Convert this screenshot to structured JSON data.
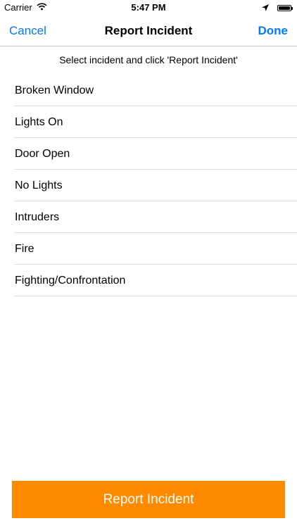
{
  "status_bar": {
    "carrier": "Carrier",
    "time": "5:47 PM",
    "icons": [
      "wifi-icon",
      "location-arrow-icon",
      "battery-icon"
    ]
  },
  "nav": {
    "cancel_label": "Cancel",
    "title": "Report Incident",
    "done_label": "Done"
  },
  "instruction": "Select incident and click 'Report Incident'",
  "incidents": [
    {
      "label": "Broken Window"
    },
    {
      "label": "Lights On"
    },
    {
      "label": "Door Open"
    },
    {
      "label": "No Lights"
    },
    {
      "label": "Intruders"
    },
    {
      "label": "Fire"
    },
    {
      "label": "Fighting/Confrontation"
    }
  ],
  "report_button_label": "Report Incident",
  "colors": {
    "accent_blue": "#007aff",
    "button_orange": "#ff8a00",
    "separator": "#dcdce0"
  }
}
